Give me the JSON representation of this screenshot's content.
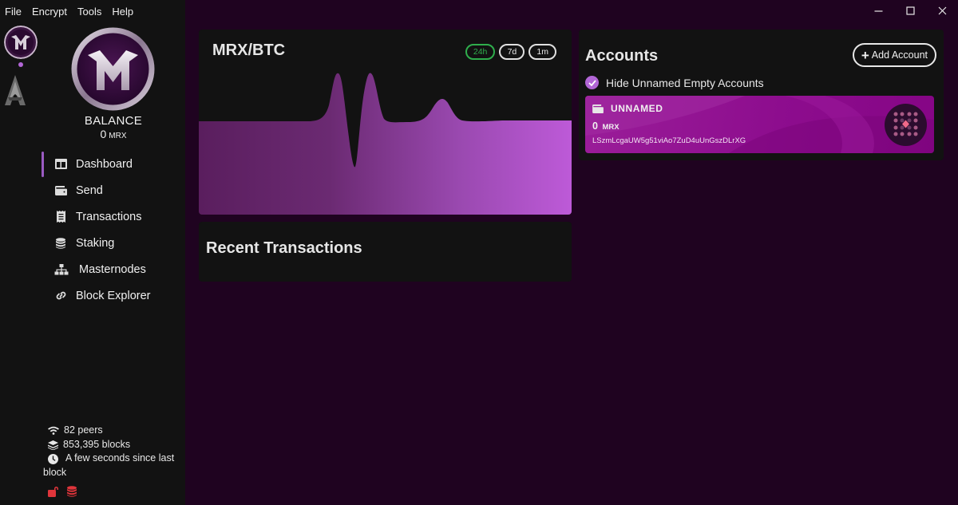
{
  "menu": [
    "File",
    "Encrypt",
    "Tools",
    "Help"
  ],
  "sidebar": {
    "balance_label": "BALANCE",
    "balance_value": "0",
    "balance_unit": "MRX",
    "nav": [
      {
        "label": "Dashboard",
        "icon": "dashboard-icon",
        "active": true
      },
      {
        "label": "Send",
        "icon": "wallet-icon",
        "active": false
      },
      {
        "label": "Transactions",
        "icon": "receipt-icon",
        "active": false
      },
      {
        "label": "Staking",
        "icon": "coins-icon",
        "active": false
      },
      {
        "label": "Masternodes",
        "icon": "network-icon",
        "active": false
      },
      {
        "label": "Block Explorer",
        "icon": "link-icon",
        "active": false
      }
    ],
    "status": {
      "peers": "82 peers",
      "blocks": "853,395 blocks",
      "last_block": "A few seconds since last block"
    },
    "status_icons": [
      "unlocked-icon",
      "staking-coins-icon"
    ]
  },
  "chart": {
    "title": "MRX/BTC",
    "ranges": [
      "24h",
      "7d",
      "1m"
    ],
    "selected_range": "24h"
  },
  "recent": {
    "title": "Recent Transactions"
  },
  "accounts": {
    "title": "Accounts",
    "add_label": "Add Account",
    "hide_label": "Hide Unnamed Empty Accounts",
    "hide_checked": true,
    "items": [
      {
        "name": "UNNAMED",
        "balance": "0",
        "unit": "MRX",
        "address": "LSzmLcgaUW5g51viAo7ZuD4uUnGszDLrXG"
      }
    ]
  },
  "colors": {
    "background": "#1f0320",
    "sidebar": "#121212",
    "card": "#121212",
    "accent": "#b266d6",
    "selected_range": "#2fae4c",
    "account_card": "#8d0d8e"
  }
}
